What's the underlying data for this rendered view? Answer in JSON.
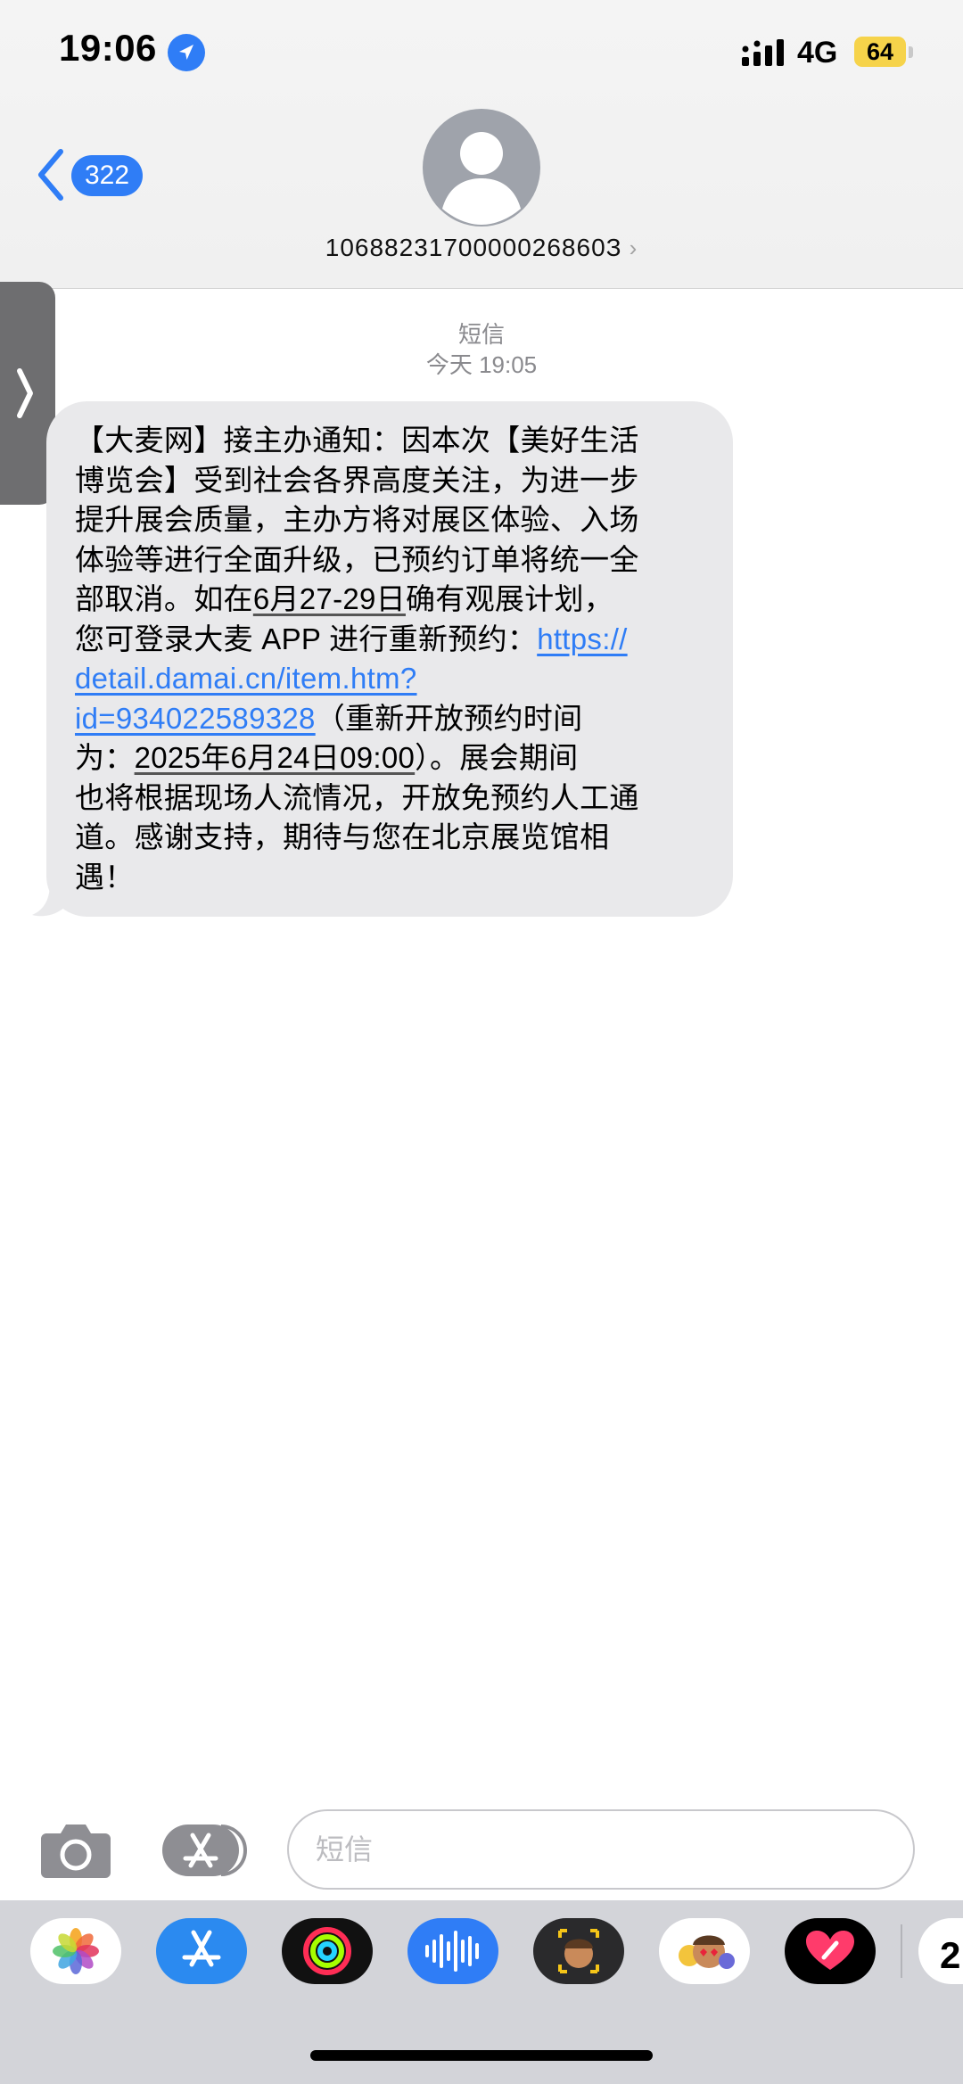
{
  "status_bar": {
    "time": "19:06",
    "network": "4G",
    "battery": "64",
    "icons": [
      "location-arrow-icon",
      "signal-icon",
      "battery-icon"
    ]
  },
  "header": {
    "back_count": "322",
    "contact": "1068823170000026860З",
    "icons": [
      "chevron-left-icon",
      "person-avatar-icon",
      "chevron-right-icon"
    ]
  },
  "thread": {
    "service": "短信",
    "timestamp": "今天 19:05",
    "message": {
      "line1": "【大麦网】接主办通知：因本次【美好生活",
      "line2": "博览会】受到社会各界高度关注，为进一步",
      "line3": "提升展会质量，主办方将对展区体验、入场",
      "line4": "体验等进行全面升级，已预约订单将统一全",
      "line5_a": "部取消。如在",
      "line5_date": "6月27-29日",
      "line5_b": "确有观展计划，",
      "line6_a": "您可登录大麦 APP 进行重新预约：",
      "link_1": "https://",
      "link_2": "detail.damai.cn/item.htm?",
      "link_3": "id=934022589328",
      "line8_b": "（重新开放预约时间",
      "line9_a": "为：",
      "line9_date": "2025年6月24日09:00",
      "line9_b": "）。展会期间",
      "line10": "也将根据现场人流情况，开放免预约人工通",
      "line11": "道。感谢支持，期待与您在北京展览馆相",
      "line12": "遇！"
    }
  },
  "composer": {
    "placeholder": "短信",
    "icons": [
      "camera-icon",
      "app-store-icon"
    ]
  },
  "app_drawer": {
    "apps": [
      "photos",
      "app-store",
      "fitness",
      "audio-message",
      "memoji",
      "memoji-stickers",
      "digital-touch",
      "calendar"
    ],
    "calendar_partial": "2"
  },
  "colors": {
    "accent": "#2f7df6",
    "bubble": "#e9e9eb",
    "battery": "#f6d34a"
  }
}
